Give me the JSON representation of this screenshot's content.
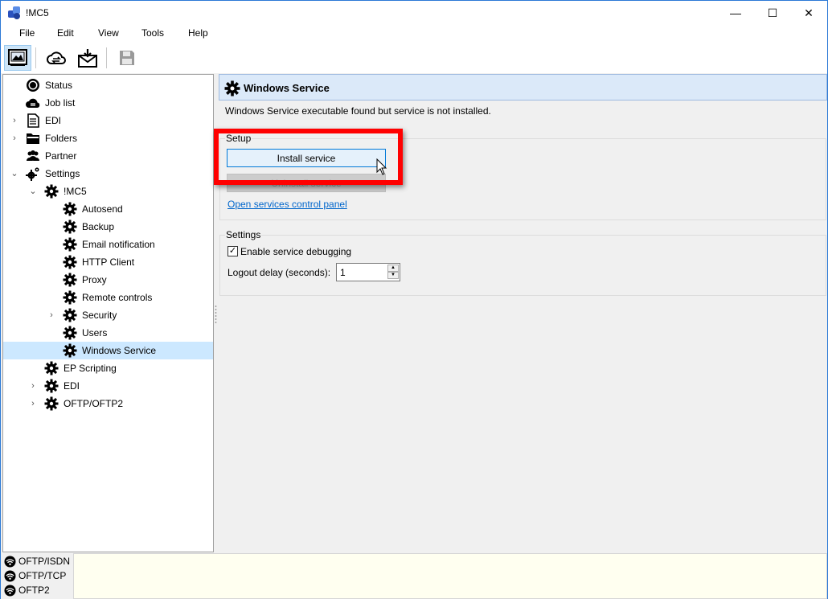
{
  "window": {
    "title": "!MC5",
    "controls": {
      "minimize": "—",
      "maximize": "☐",
      "close": "✕"
    }
  },
  "menu": [
    "File",
    "Edit",
    "View",
    "Tools",
    "Help"
  ],
  "toolbar": {
    "buttons": [
      "dashboard-icon",
      "cloud-sync-icon",
      "inbox-download-icon",
      "save-icon"
    ]
  },
  "tree": {
    "items": [
      {
        "label": "Status",
        "icon": "status-icon"
      },
      {
        "label": "Job list",
        "icon": "cloud-icon"
      },
      {
        "label": "EDI",
        "icon": "document-icon",
        "expander": "›"
      },
      {
        "label": "Folders",
        "icon": "folder-icon",
        "expander": "›"
      },
      {
        "label": "Partner",
        "icon": "people-icon"
      },
      {
        "label": "Settings",
        "icon": "gears-icon",
        "expander": "⌄"
      },
      {
        "label": "!MC5",
        "icon": "gear-icon",
        "expander": "⌄"
      },
      {
        "label": "Autosend",
        "icon": "gear-icon"
      },
      {
        "label": "Backup",
        "icon": "gear-icon"
      },
      {
        "label": "Email notification",
        "icon": "gear-icon"
      },
      {
        "label": "HTTP Client",
        "icon": "gear-icon"
      },
      {
        "label": "Proxy",
        "icon": "gear-icon"
      },
      {
        "label": "Remote controls",
        "icon": "gear-icon"
      },
      {
        "label": "Security",
        "icon": "gear-icon",
        "expander": "›"
      },
      {
        "label": "Users",
        "icon": "gear-icon"
      },
      {
        "label": "Windows Service",
        "icon": "gear-icon",
        "selected": true
      },
      {
        "label": "EP Scripting",
        "icon": "gear-icon"
      },
      {
        "label": "EDI",
        "icon": "gear-icon",
        "expander": "›"
      },
      {
        "label": "OFTP/OFTP2",
        "icon": "gear-icon",
        "expander": "›"
      }
    ]
  },
  "panel": {
    "title": "Windows Service",
    "status_message": "Windows Service executable found but service is not installed.",
    "setup": {
      "legend": "Setup",
      "install_label": "Install service",
      "uninstall_label": "Uninstall service",
      "link_label": "Open services control panel"
    },
    "settings": {
      "legend": "Settings",
      "debug_label": "Enable service debugging",
      "debug_checked": true,
      "logout_label": "Logout delay (seconds):",
      "logout_value": "1"
    }
  },
  "connections": [
    "OFTP/ISDN",
    "OFTP/TCP",
    "OFTP2"
  ],
  "colors": {
    "accent": "#0078d7",
    "selection": "#cce8ff",
    "header_bg": "#dbe9f9",
    "highlight": "#ff0000",
    "link": "#0066cc",
    "log_bg": "#fffff0"
  }
}
